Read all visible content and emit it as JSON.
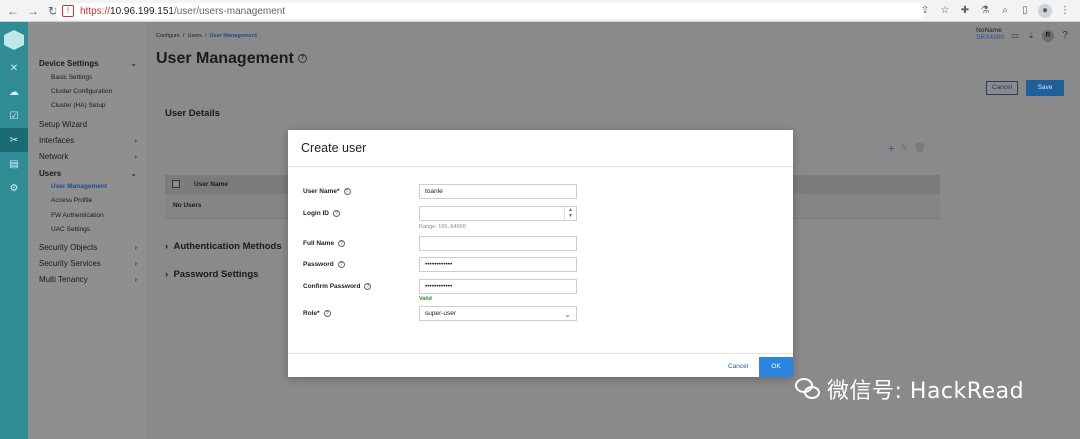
{
  "browser": {
    "url_scheme": "https://",
    "url_host": "10.96.199.151",
    "url_path": "/user/users-management",
    "nav_back": "←",
    "nav_forward": "→",
    "nav_reload": "↻"
  },
  "rail": {
    "items": [
      "close-icon",
      "cloud-icon",
      "check-icon",
      "tools-icon",
      "document-icon",
      "gear-icon"
    ],
    "active_index": 3
  },
  "sidebar": {
    "device_settings": "Device Settings",
    "basic_settings": "Basic Settings",
    "cluster_configuration": "Cluster Configuration",
    "cluster_ha_setup": "Cluster (HA) Setup",
    "setup_wizard": "Setup Wizard",
    "interfaces": "Interfaces",
    "network": "Network",
    "users": "Users",
    "user_management": "User Management",
    "access_profile": "Access Profile",
    "fw_authentication": "FW Authentication",
    "uac_settings": "UAC Settings",
    "security_objects": "Security Objects",
    "security_services": "Security Services",
    "multi_tenancy": "Multi Tenancy"
  },
  "header": {
    "breadcrumb_configure": "Configure",
    "breadcrumb_users": "Users",
    "breadcrumb_current": "User Management",
    "separator": "/",
    "title": "User Management",
    "node_name": "NoName",
    "node_model": "SRX4200",
    "avatar_letter": "R",
    "help": "?"
  },
  "page": {
    "cancel": "Cancel",
    "save": "Save",
    "section_title": "User Details",
    "column_user_name": "User Name",
    "empty_text": "No Users",
    "authentication_methods": "Authentication Methods",
    "password_settings": "Password Settings"
  },
  "modal": {
    "title": "Create user",
    "user_name_label": "User Name*",
    "user_name_value": "toanle",
    "login_id_label": "Login ID",
    "login_id_value": "",
    "login_id_hint": "Range: 100..64000",
    "full_name_label": "Full Name",
    "full_name_value": "",
    "password_label": "Password",
    "password_value": "••••••••••••",
    "confirm_password_label": "Confirm Password",
    "confirm_password_value": "••••••••••••",
    "valid_text": "Valid",
    "role_label": "Role*",
    "role_value": "super-user",
    "cancel": "Cancel",
    "ok": "OK"
  },
  "watermark": {
    "text": "微信号: HackRead"
  }
}
